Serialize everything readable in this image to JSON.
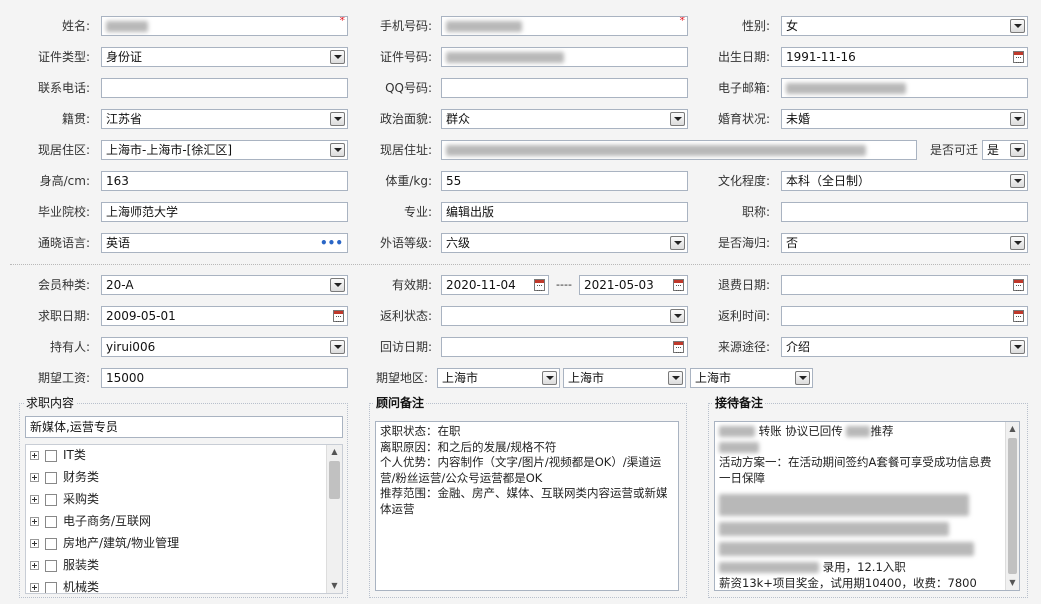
{
  "labels": {
    "name": "姓名:",
    "mobile": "手机号码:",
    "gender": "性别:",
    "id_type": "证件类型:",
    "id_no": "证件号码:",
    "birth": "出生日期:",
    "phone": "联系电话:",
    "qq": "QQ号码:",
    "email": "电子邮箱:",
    "origin": "籍贯:",
    "politics": "政治面貌:",
    "marital": "婚育状况:",
    "residence_area": "现居住区:",
    "residence_addr": "现居住址:",
    "relocate": "是否可迁",
    "height": "身高/cm:",
    "weight": "体重/kg:",
    "education": "文化程度:",
    "school": "毕业院校:",
    "major": "专业:",
    "title": "职称:",
    "language": "通晓语言:",
    "lang_level": "外语等级:",
    "overseas": "是否海归:",
    "member_type": "会员种类:",
    "valid": "有效期:",
    "refund_date": "退费日期:",
    "job_date": "求职日期:",
    "rebate_status": "返利状态:",
    "rebate_time": "返利时间:",
    "holder": "持有人:",
    "visit_date": "回访日期:",
    "source": "来源途径:",
    "salary": "期望工资:",
    "region": "期望地区:",
    "valid_sep": "----"
  },
  "values": {
    "gender": "女",
    "id_type": "身份证",
    "birth": "1991-11-16",
    "origin": "江苏省",
    "politics": "群众",
    "marital": "未婚",
    "residence_area": "上海市-上海市-[徐汇区]",
    "relocate": "是",
    "height": "163",
    "weight": "55",
    "education": "本科（全日制）",
    "school": "上海师范大学",
    "major": "编辑出版",
    "language": "英语",
    "lang_level": "六级",
    "overseas": "否",
    "member_type": "20-A",
    "valid_from": "2020-11-04",
    "valid_to": "2021-05-03",
    "job_date": "2009-05-01",
    "holder": "yirui006",
    "source": "介绍",
    "salary": "15000",
    "region1": "上海市",
    "region2": "上海市",
    "region3": "上海市"
  },
  "job_panel": {
    "title": "求职内容",
    "selected": "新媒体,运营专员",
    "items": [
      "IT类",
      "财务类",
      "采购类",
      "电子商务/互联网",
      "房地产/建筑/物业管理",
      "服装类",
      "机械类"
    ]
  },
  "advisor_panel": {
    "title": "顾问备注",
    "lines": [
      "求职状态：在职",
      "离职原因：和之后的发展/规格不符",
      "个人优势：内容制作（文字/图片/视频都是OK）/渠道运营/粉丝运营/公众号运营都是OK",
      "推荐范围：金融、房产、媒体、互联网类内容运营或新媒体运营"
    ]
  },
  "reception_panel": {
    "title": "接待备注",
    "line1_a": "转账 协议已回传",
    "line1_b": "推荐",
    "line3": "活动方案一：在活动期间签约A套餐可享受成功信息费一日保障",
    "line_hire": "录用，12.1入职",
    "line_pay": "薪资13k+项目奖金，试用期10400，收费：7800"
  },
  "scroll_arrows": {
    "up": "▲",
    "down": "▼"
  },
  "required_mark": "*",
  "ellipsis": "•••"
}
